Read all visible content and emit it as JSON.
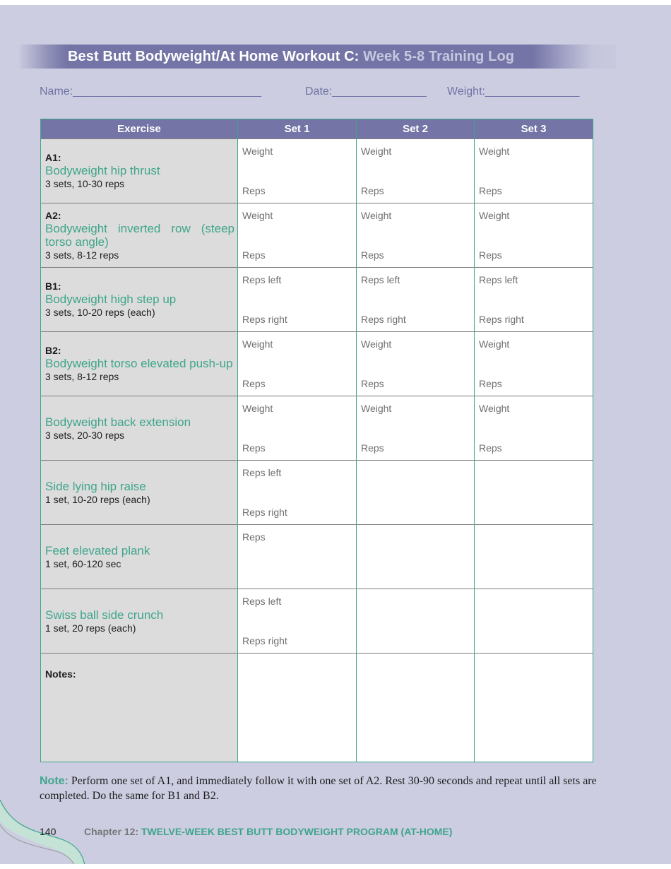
{
  "header": {
    "title_part1": "Best Butt Bodyweight/At Home",
    "title_part2": "Workout C:",
    "title_part3": "Week 5-8 Training Log"
  },
  "info": {
    "name_label": "Name:",
    "name_line": "______________________________",
    "date_label": "Date:",
    "date_line": "_______________",
    "weight_label": "Weight:",
    "weight_line": "_______________"
  },
  "table": {
    "headers": [
      "Exercise",
      "Set 1",
      "Set 2",
      "Set 3"
    ],
    "rows": [
      {
        "code": "A1:",
        "name": "Bodyweight hip thrust",
        "sets": "3 sets, 10-30 reps",
        "cells": [
          [
            "Weight",
            "Reps"
          ],
          [
            "Weight",
            "Reps"
          ],
          [
            "Weight",
            "Reps"
          ]
        ]
      },
      {
        "code": "A2:",
        "name": "Bodyweight inverted row (steep torso angle)",
        "sets": "3 sets, 8-12 reps",
        "cells": [
          [
            "Weight",
            "Reps"
          ],
          [
            "Weight",
            "Reps"
          ],
          [
            "Weight",
            "Reps"
          ]
        ]
      },
      {
        "code": "B1:",
        "name": "Bodyweight high step up",
        "sets": "3 sets, 10-20 reps (each)",
        "cells": [
          [
            "Reps left",
            "Reps right"
          ],
          [
            "Reps left",
            "Reps right"
          ],
          [
            "Reps left",
            "Reps right"
          ]
        ]
      },
      {
        "code": "B2:",
        "name": "Bodyweight torso elevated push-up",
        "sets": "3 sets, 8-12 reps",
        "cells": [
          [
            "Weight",
            "Reps"
          ],
          [
            "Weight",
            "Reps"
          ],
          [
            "Weight",
            "Reps"
          ]
        ]
      },
      {
        "code": "",
        "name": "Bodyweight back extension",
        "sets": "3 sets, 20-30 reps",
        "cells": [
          [
            "Weight",
            "Reps"
          ],
          [
            "Weight",
            "Reps"
          ],
          [
            "Weight",
            "Reps"
          ]
        ]
      },
      {
        "code": "",
        "name": "Side lying hip raise",
        "sets": "1 set, 10-20 reps (each)",
        "cells": [
          [
            "Reps left",
            "Reps right"
          ],
          [
            "",
            ""
          ],
          [
            "",
            ""
          ]
        ]
      },
      {
        "code": "",
        "name": "Feet elevated plank",
        "sets": "1 set, 60-120 sec",
        "cells": [
          [
            "Reps",
            ""
          ],
          [
            "",
            ""
          ],
          [
            "",
            ""
          ]
        ]
      },
      {
        "code": "",
        "name": "Swiss ball side crunch",
        "sets": "1 set, 20 reps (each)",
        "cells": [
          [
            "Reps left",
            "Reps right"
          ],
          [
            "",
            ""
          ],
          [
            "",
            ""
          ]
        ]
      }
    ],
    "notes_label": "Notes:"
  },
  "note": {
    "label": "Note:",
    "text": " Perform one set of A1, and immediately follow it with one set of A2. Rest 30-90 seconds and repeat until all sets are completed. Do the same for B1 and B2."
  },
  "footer": {
    "page_number": "140",
    "chapter_label": "Chapter 12:",
    "chapter_title": " TWELVE-WEEK BEST BUTT BODYWEIGHT PROGRAM (AT-HOME)"
  },
  "colors": {
    "page_bg": "#cccde1",
    "header_purple": "#7474a6",
    "accent_green": "#3ea58a",
    "exercise_cell_bg": "#dcdcdc"
  }
}
